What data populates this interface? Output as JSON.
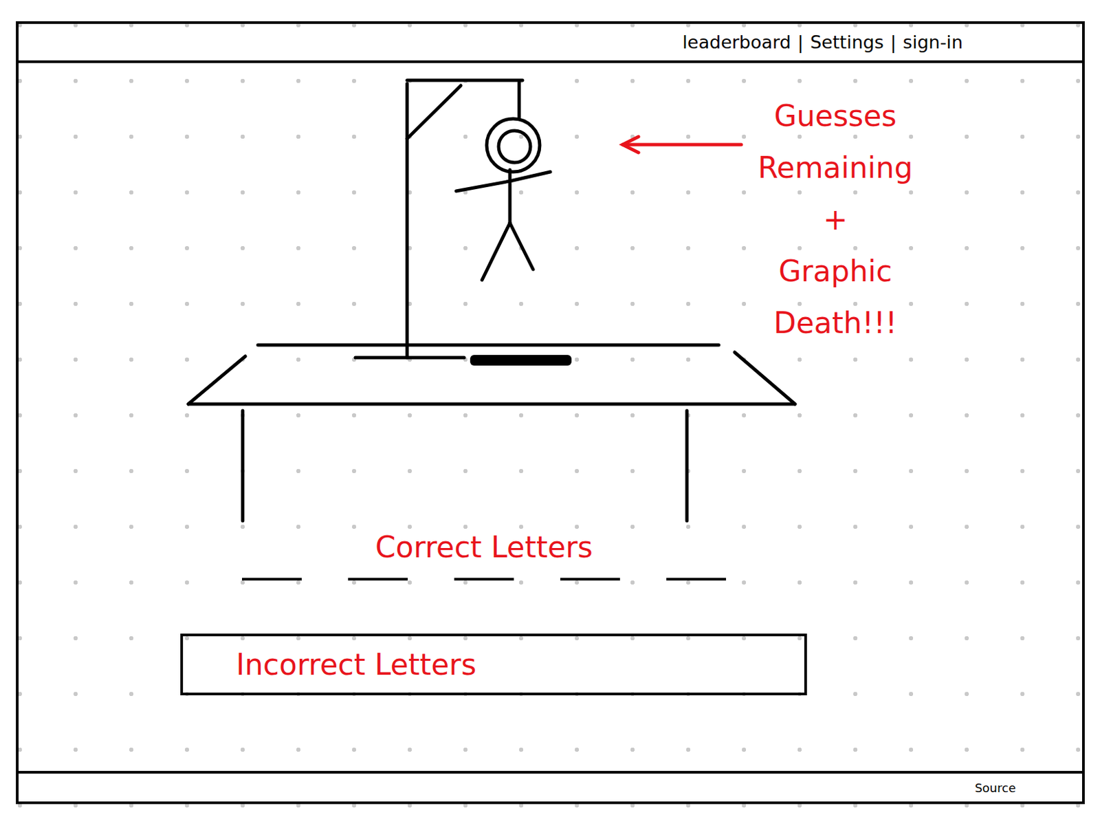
{
  "nav": {
    "items": [
      {
        "label": "leaderboard"
      },
      {
        "label": "Settings"
      },
      {
        "label": "sign-in"
      }
    ],
    "separator": "|"
  },
  "hangman": {
    "parts_shown": 6
  },
  "annotation": {
    "lines": [
      "Guesses",
      "Remaining",
      "+",
      "Graphic",
      "Death!!!"
    ]
  },
  "correct_letters": {
    "label": "Correct Letters",
    "blanks": 5
  },
  "incorrect_letters": {
    "label": "Incorrect Letters"
  },
  "footer": {
    "label": "Source"
  }
}
